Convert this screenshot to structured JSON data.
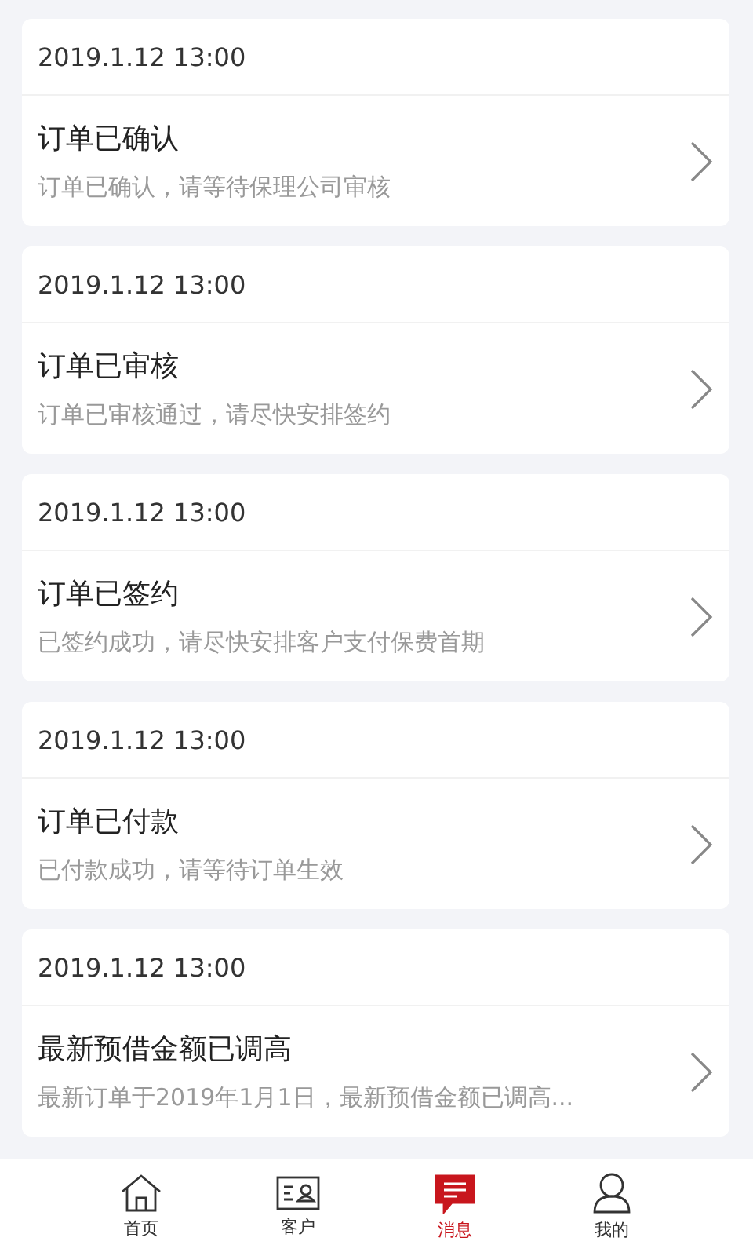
{
  "messages": [
    {
      "time": "2019.1.12  13:00",
      "title": "订单已确认",
      "summary": "订单已确认，请等待保理公司审核"
    },
    {
      "time": "2019.1.12  13:00",
      "title": "订单已审核",
      "summary": "订单已审核通过，请尽快安排签约"
    },
    {
      "time": "2019.1.12  13:00",
      "title": "订单已签约",
      "summary": "已签约成功，请尽快安排客户支付保费首期"
    },
    {
      "time": "2019.1.12  13:00",
      "title": "订单已付款",
      "summary": "已付款成功，请等待订单生效"
    },
    {
      "time": "2019.1.12  13:00",
      "title": "最新预借金额已调高",
      "summary": "最新订单于2019年1月1日，最新预借金额已调高..."
    }
  ],
  "tab_bar": [
    {
      "kind": "home",
      "label": "首页",
      "selected": false
    },
    {
      "kind": "clients",
      "label": "客户",
      "selected": false
    },
    {
      "kind": "messages",
      "label": "消息",
      "selected": true
    },
    {
      "kind": "me",
      "label": "我的",
      "selected": false
    }
  ]
}
